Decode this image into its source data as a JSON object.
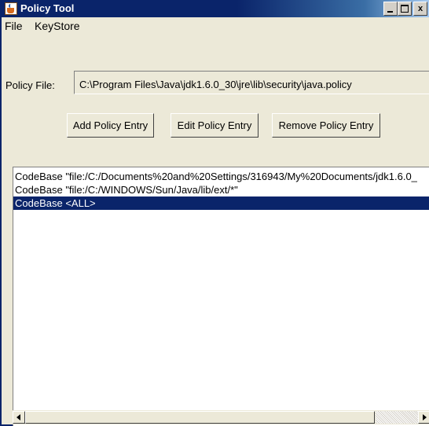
{
  "window": {
    "title": "Policy Tool"
  },
  "menu": {
    "items": [
      "File",
      "KeyStore"
    ]
  },
  "policy_file": {
    "label": "Policy File:",
    "value": "C:\\Program Files\\Java\\jdk1.6.0_30\\jre\\lib\\security\\java.policy"
  },
  "buttons": {
    "add": "Add Policy Entry",
    "edit": "Edit Policy Entry",
    "remove": "Remove Policy Entry"
  },
  "entries": [
    "CodeBase \"file:/C:/Documents%20and%20Settings/316943/My%20Documents/jdk1.6.0_",
    "CodeBase \"file:/C:/WINDOWS/Sun/Java/lib/ext/*\"",
    "CodeBase <ALL>"
  ],
  "selected_entry_index": 2,
  "colors": {
    "titlebar": "#0a246a",
    "selection": "#0a246a",
    "window_bg": "#ece9d8"
  }
}
